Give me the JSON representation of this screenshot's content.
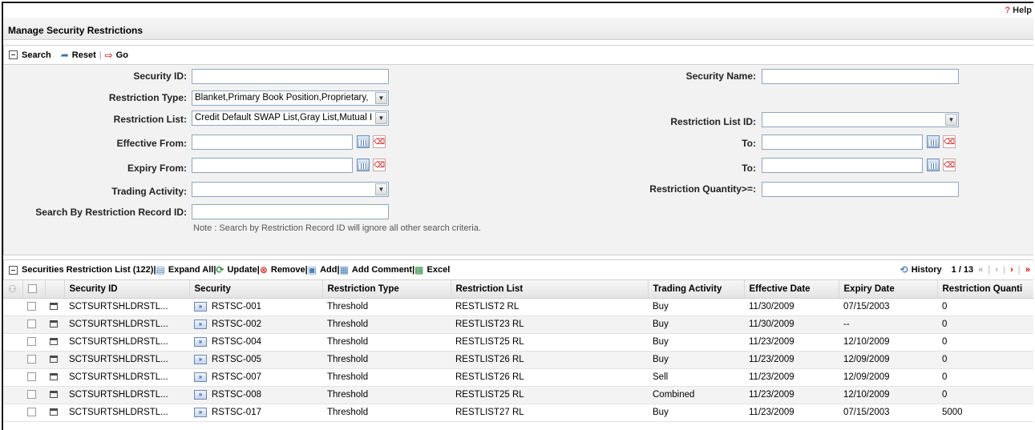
{
  "help": {
    "label": "Help"
  },
  "page_title": "Manage Security Restrictions",
  "search_toolbar": {
    "title": "Search",
    "reset_label": "Reset",
    "go_label": "Go"
  },
  "search_form": {
    "security_id": {
      "label": "Security ID:",
      "value": ""
    },
    "security_name": {
      "label": "Security Name:",
      "value": ""
    },
    "restriction_type": {
      "label": "Restriction Type:",
      "value": "Blanket,Primary Book Position,Proprietary,"
    },
    "restriction_list": {
      "label": "Restriction List:",
      "value": "Credit Default SWAP List,Gray List,Mutual I"
    },
    "restriction_list_id": {
      "label": "Restriction List ID:",
      "value": ""
    },
    "effective_from": {
      "label": "Effective From:",
      "value": ""
    },
    "effective_to": {
      "label": "To:",
      "value": ""
    },
    "expiry_from": {
      "label": "Expiry From:",
      "value": ""
    },
    "expiry_to": {
      "label": "To:",
      "value": ""
    },
    "trading_activity": {
      "label": "Trading Activity:",
      "value": ""
    },
    "restriction_quantity": {
      "label": "Restriction Quantity>=:",
      "value": ""
    },
    "record_id": {
      "label": "Search By Restriction Record ID:",
      "value": ""
    },
    "note": "Note : Search by Restriction Record ID will ignore all other search criteria."
  },
  "list_toolbar": {
    "title": "Securities Restriction List (122)",
    "expand_all": "Expand All",
    "update": "Update",
    "remove": "Remove",
    "add": "Add",
    "add_comment": "Add Comment",
    "excel": "Excel",
    "history": "History",
    "page_info": "1 / 13"
  },
  "table": {
    "columns": [
      "Security ID",
      "Security",
      "Restriction Type",
      "Restriction List",
      "Trading Activity",
      "Effective Date",
      "Expiry Date",
      "Restriction Quanti"
    ],
    "rows": [
      [
        "SCTSURTSHLDRSTL...",
        "RSTSC-001",
        "Threshold",
        "RESTLIST2 RL",
        "Buy",
        "11/30/2009",
        "07/15/2003",
        "0"
      ],
      [
        "SCTSURTSHLDRSTL...",
        "RSTSC-002",
        "Threshold",
        "RESTLIST23 RL",
        "Buy",
        "11/30/2009",
        "--",
        "0"
      ],
      [
        "SCTSURTSHLDRSTL...",
        "RSTSC-004",
        "Threshold",
        "RESTLIST25 RL",
        "Buy",
        "11/23/2009",
        "12/10/2009",
        "0"
      ],
      [
        "SCTSURTSHLDRSTL...",
        "RSTSC-005",
        "Threshold",
        "RESTLIST26 RL",
        "Buy",
        "11/23/2009",
        "12/09/2009",
        "0"
      ],
      [
        "SCTSURTSHLDRSTL...",
        "RSTSC-007",
        "Threshold",
        "RESTLIST26 RL",
        "Sell",
        "11/23/2009",
        "12/09/2009",
        "0"
      ],
      [
        "SCTSURTSHLDRSTL...",
        "RSTSC-008",
        "Threshold",
        "RESTLIST25 RL",
        "Combined",
        "11/23/2009",
        "12/10/2009",
        "0"
      ],
      [
        "SCTSURTSHLDRSTL...",
        "RSTSC-017",
        "Threshold",
        "RESTLIST27 RL",
        "Buy",
        "11/23/2009",
        "07/15/2003",
        "5000"
      ]
    ]
  }
}
